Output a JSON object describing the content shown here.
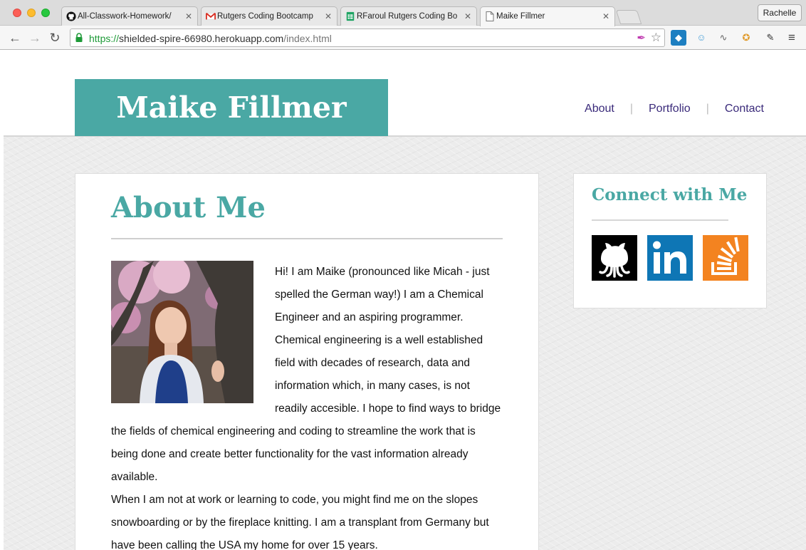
{
  "browser": {
    "tabs": [
      {
        "title": "All-Classwork-Homework/",
        "icon": "github-icon"
      },
      {
        "title": "Rutgers Coding Bootcamp",
        "icon": "gmail-icon"
      },
      {
        "title": "RFaroul Rutgers Coding Bo",
        "icon": "sheets-icon"
      },
      {
        "title": "Maike Fillmer",
        "icon": "document-icon",
        "active": true
      }
    ],
    "profile": "Rachelle",
    "url": {
      "scheme": "https://",
      "host": "shielded-spire-66980.herokuapp.com",
      "path": "/index.html"
    }
  },
  "site": {
    "brand": "Maike Fillmer",
    "accent_color": "#4aa8a4",
    "nav": [
      "About",
      "Portfolio",
      "Contact"
    ],
    "nav_separator": "|"
  },
  "about": {
    "title": "About Me",
    "paragraph1": "Hi! I am Maike (pronounced like Micah - just spelled the German way!) I am a Chemical Engineer and an aspiring programmer. Chemical engineering is a well established field with decades of research, data and information which, in many cases, is not readily accesible. I hope to find ways to bridge the fields of chemical engineering and coding to streamline the work that is being done and create better functionality for the vast information already available.",
    "paragraph2": "When I am not at work or learning to code, you might find me on the slopes snowboarding or by the fireplace knitting. I am a transplant from Germany but have been calling the USA my home for over 15 years."
  },
  "connect": {
    "title": "Connect with Me",
    "links": [
      {
        "name": "github-icon",
        "color": "#000000"
      },
      {
        "name": "linkedin-icon",
        "color": "#0e76b5"
      },
      {
        "name": "stackoverflow-icon",
        "color": "#f38320"
      }
    ]
  }
}
